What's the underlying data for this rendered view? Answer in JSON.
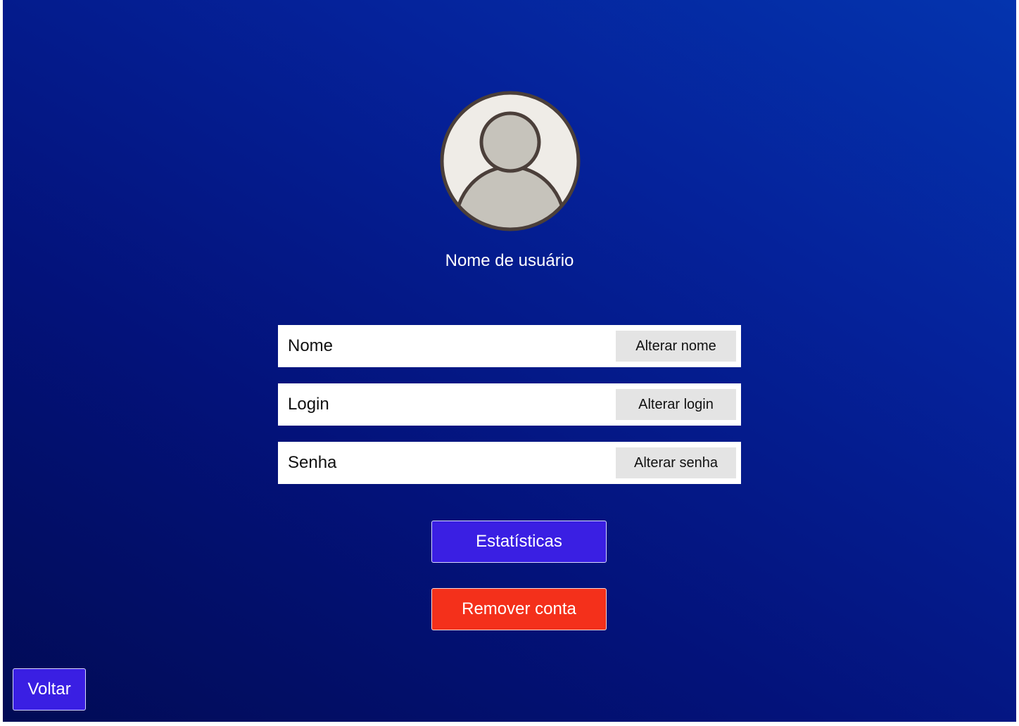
{
  "profile": {
    "avatar_icon": "user-avatar-icon",
    "username": "Nome de usuário"
  },
  "fields": [
    {
      "label": "Nome",
      "button_label": "Alterar nome"
    },
    {
      "label": "Login",
      "button_label": "Alterar login"
    },
    {
      "label": "Senha",
      "button_label": "Alterar senha"
    }
  ],
  "actions": {
    "stats_label": "Estatísticas",
    "remove_label": "Remover conta",
    "back_label": "Voltar"
  },
  "colors": {
    "background_dark": "#010b55",
    "background_light": "#0434ae",
    "primary_button": "#3a1fe3",
    "danger_button": "#f4301b",
    "secondary_button": "#e4e4e4",
    "avatar_bg": "#efece7",
    "avatar_figure": "#c6c3bb",
    "avatar_outline": "#4b3f3a"
  }
}
